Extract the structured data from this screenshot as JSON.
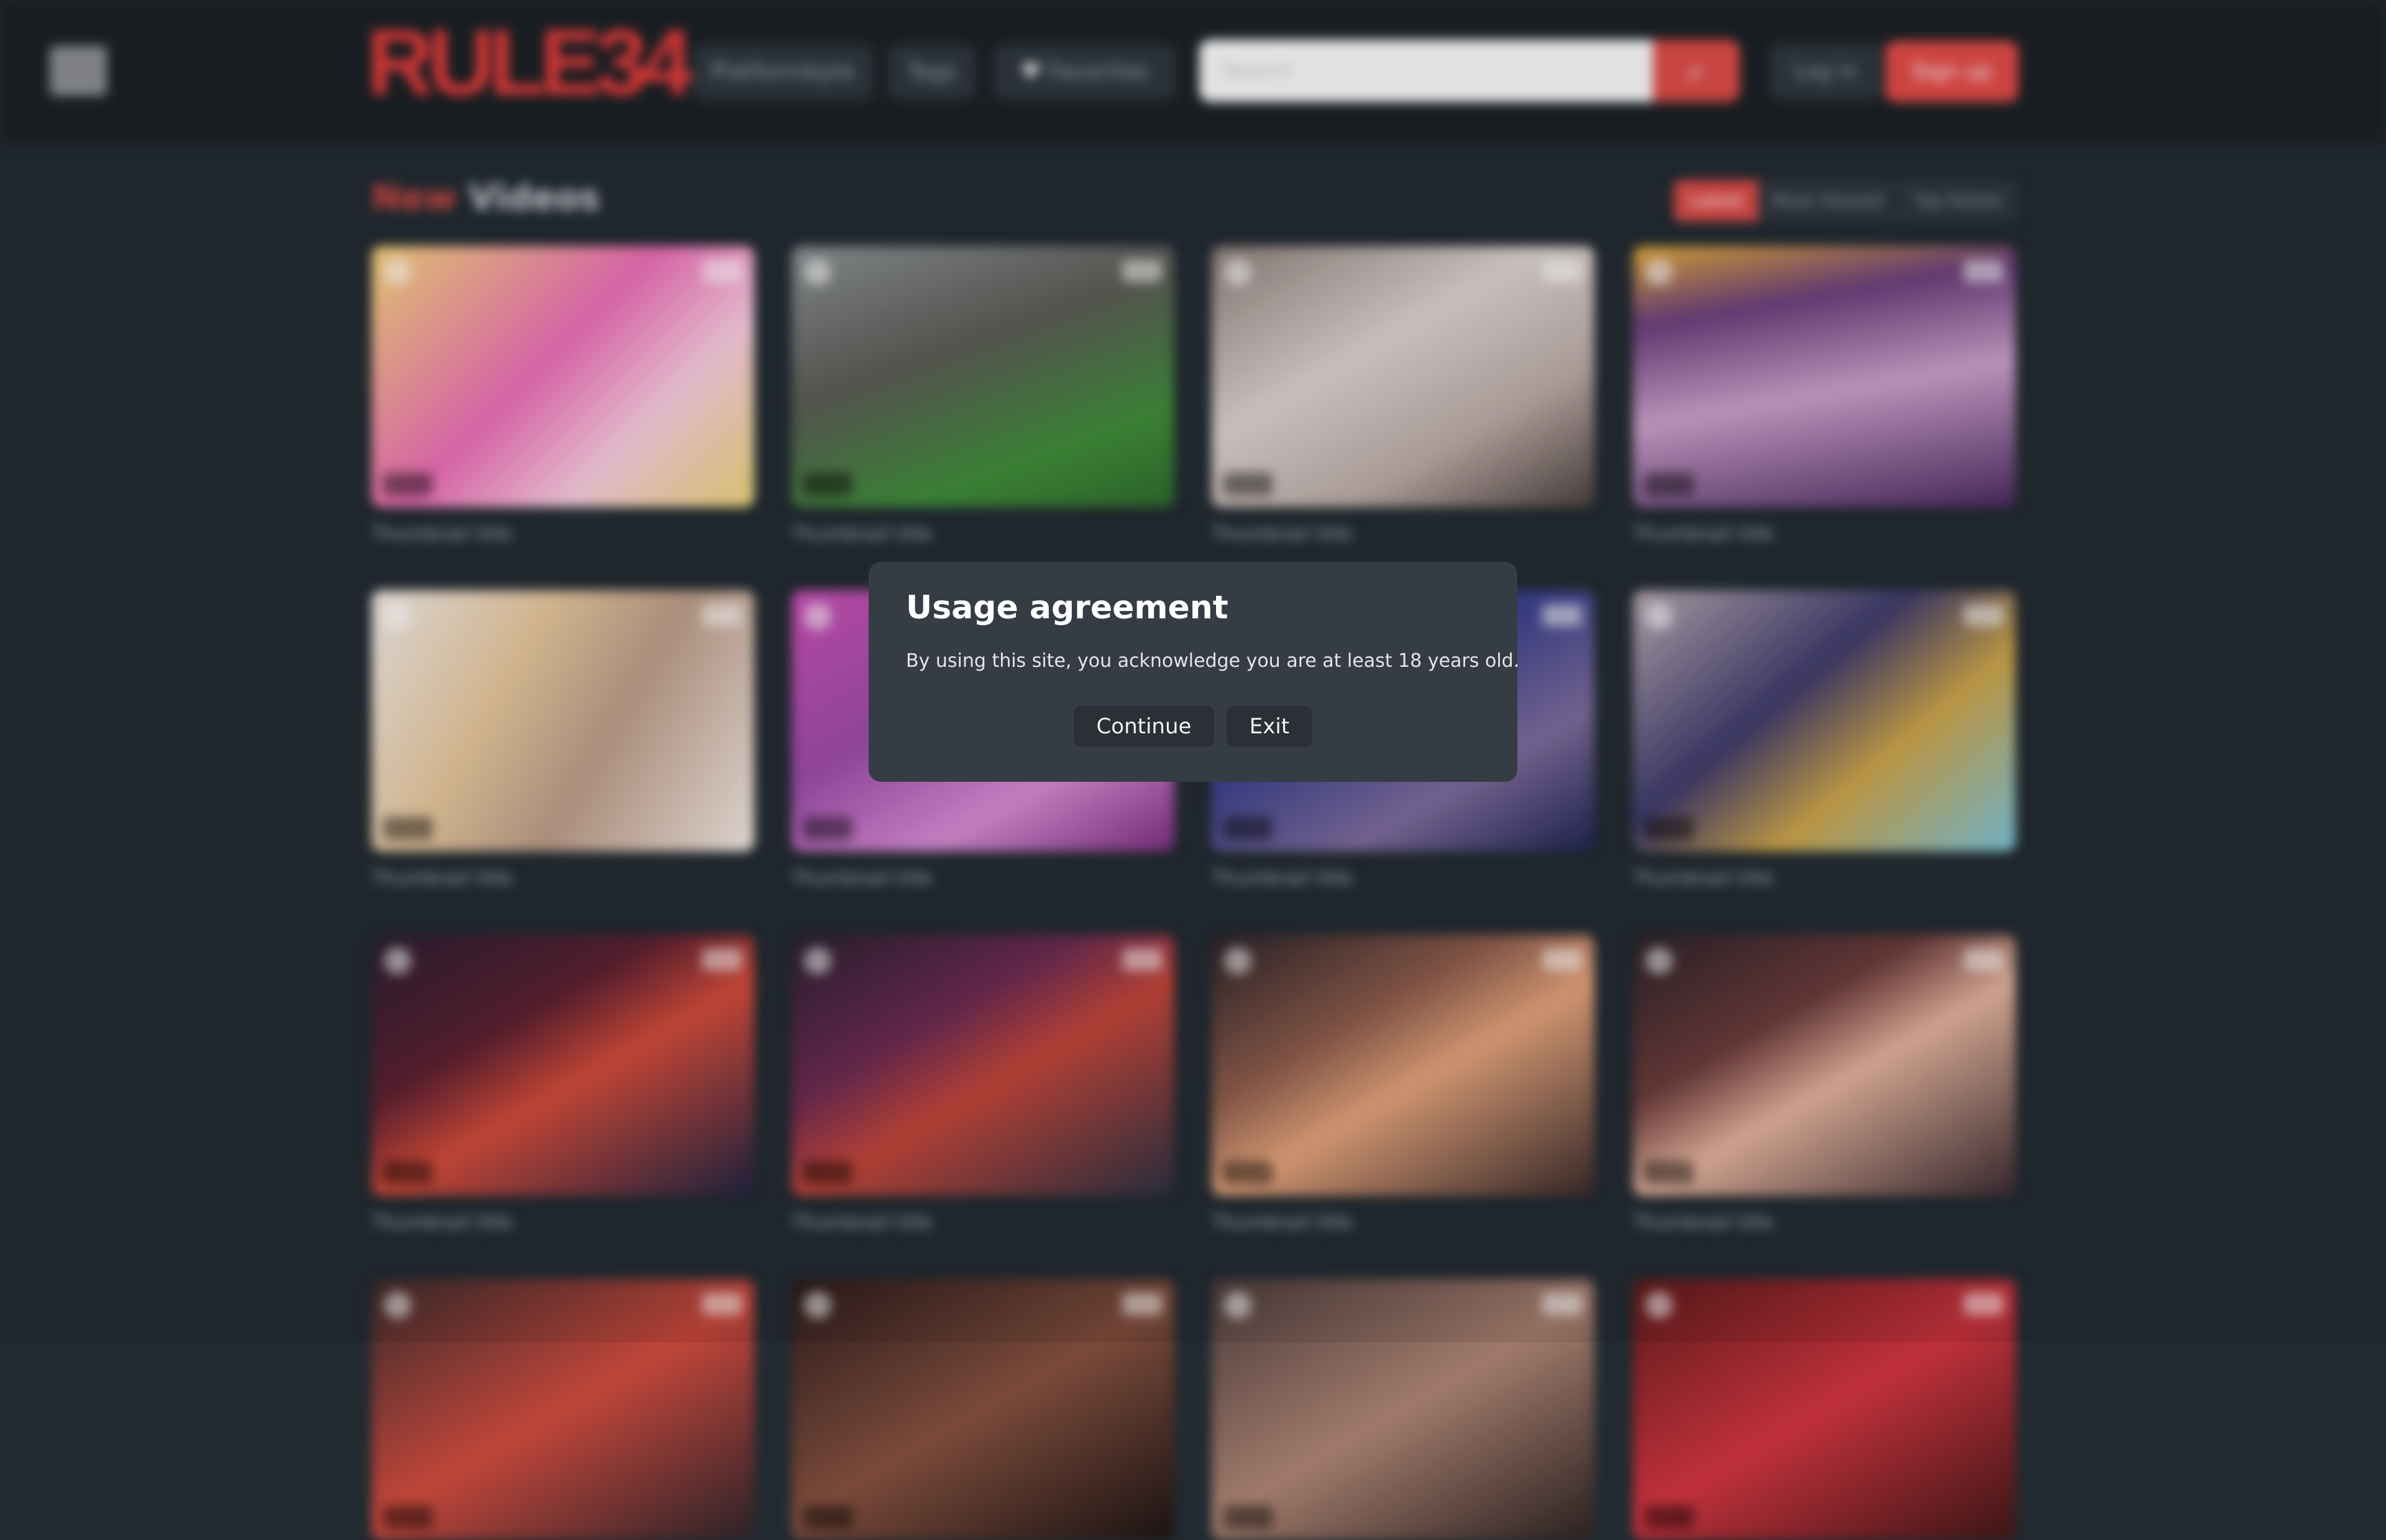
{
  "header": {
    "logo_text": "RULE34",
    "logo_subtitle": "",
    "nav": [
      {
        "label": "Platformbyte"
      },
      {
        "label": "Tags"
      },
      {
        "label": "Favorites"
      }
    ],
    "search_placeholder": "Search",
    "login_label": "Log in",
    "signup_label": "Sign up"
  },
  "section": {
    "title_accent": "New",
    "title_rest": "Videos",
    "sort_tabs": [
      "Latest",
      "Most Viewed",
      "Top Rated"
    ]
  },
  "videos": [
    {
      "title": "Thumbnail title",
      "age": "",
      "count": ""
    },
    {
      "title": "Thumbnail title",
      "age": "",
      "count": ""
    },
    {
      "title": "Thumbnail title",
      "age": "",
      "count": ""
    },
    {
      "title": "Thumbnail title",
      "age": "",
      "count": ""
    },
    {
      "title": "Thumbnail title",
      "age": "",
      "count": ""
    },
    {
      "title": "Thumbnail title",
      "age": "",
      "count": ""
    },
    {
      "title": "Thumbnail title",
      "age": "",
      "count": ""
    },
    {
      "title": "Thumbnail title",
      "age": "",
      "count": ""
    },
    {
      "title": "Thumbnail title",
      "age": "",
      "count": ""
    },
    {
      "title": "Thumbnail title",
      "age": "",
      "count": ""
    },
    {
      "title": "Thumbnail title",
      "age": "",
      "count": ""
    },
    {
      "title": "Thumbnail title",
      "age": "",
      "count": ""
    },
    {
      "title": "",
      "age": "",
      "count": ""
    },
    {
      "title": "",
      "age": "",
      "count": ""
    },
    {
      "title": "",
      "age": "",
      "count": ""
    },
    {
      "title": "",
      "age": "",
      "count": ""
    }
  ],
  "modal": {
    "title": "Usage agreement",
    "text": "By using this site, you acknowledge you are at least 18 years old.",
    "continue_label": "Continue",
    "exit_label": "Exit"
  },
  "colors": {
    "background": "#222a31",
    "header": "#1b2024",
    "accent_red": "#d84b47",
    "modal_bg": "#353c44",
    "modal_button": "#2a3036"
  },
  "icons": {
    "menu": "hamburger-icon",
    "search": "search-icon",
    "favorites": "heart-icon"
  }
}
